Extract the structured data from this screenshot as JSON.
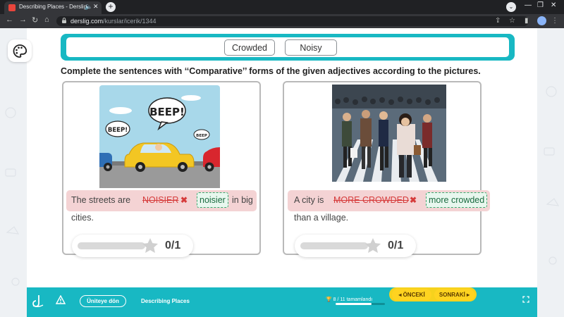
{
  "browser": {
    "tab_title": "Describing Places - Derslig",
    "tab_audio_icon": "speaker-icon",
    "tab_close_icon": "close-icon",
    "new_tab_label": "+",
    "url_host": "derslig.com",
    "url_path": "/kurslar/icerik/1344",
    "colors": {
      "tabbar": "#202124",
      "toolbar": "#35363a"
    }
  },
  "exercise": {
    "word_bank": [
      "Crowded",
      "Noisy"
    ],
    "instruction": "Complete the sentences with ‘‘Comparative’’ forms of the given adjectives according to the pictures.",
    "cards": [
      {
        "image": "traffic-jam-illustration",
        "image_text": [
          "BEEP!",
          "BEEP!",
          "BEEP"
        ],
        "text_before": "The streets are",
        "wrong_answer": "NOISIER",
        "correct_answer": "noisier",
        "text_after_line1": "in big",
        "text_after_line2": "cities.",
        "score": "0/1",
        "score_fraction": 0
      },
      {
        "image": "crowded-crosswalk-photo",
        "text_before": "A city is",
        "wrong_answer": "MORE CROWDED",
        "correct_answer": "more crowded",
        "text_after_line2": "than a village.",
        "score": "0/1",
        "score_fraction": 0
      }
    ],
    "colors": {
      "accent": "#18b8c3",
      "wrong": "#d63c3c",
      "correct_bg": "#e8f7ee",
      "sentence_bg": "#f4d3d4"
    }
  },
  "bottom_bar": {
    "back_label": "Üniteye dön",
    "lesson_title": "Describing Places",
    "progress_text": "8 / 11 tamamlandı",
    "progress_fraction": 0.727,
    "prev_label": "ÖNCEKİ",
    "next_label": "SONRAKİ"
  }
}
